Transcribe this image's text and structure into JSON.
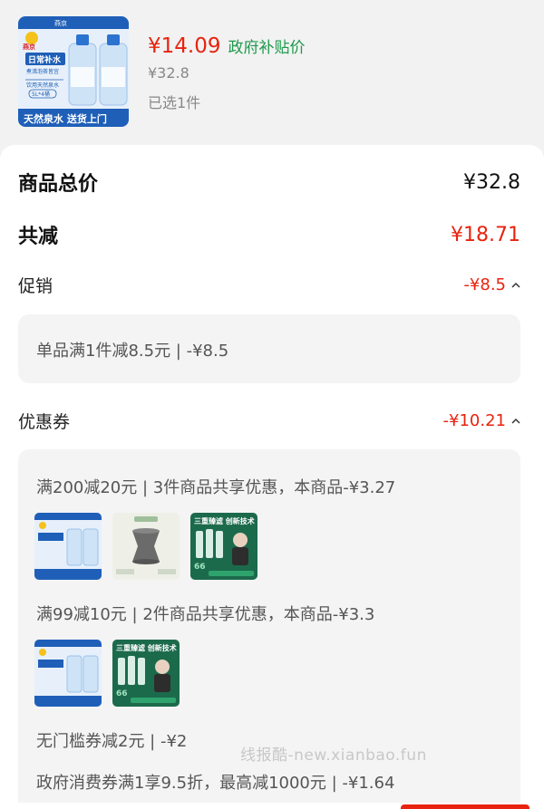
{
  "product": {
    "price": "¥14.09",
    "price_tag": "政府补贴价",
    "original_price": "¥32.8",
    "selected_count": "已选1件",
    "thumb": {
      "brand": "燕京",
      "badge_top": "日常补水",
      "badge_sub": "煮沸泡茶皆宜",
      "label": "饮用天然泉水",
      "spec": "5L*4桶",
      "banner": "天然泉水 送货上门"
    }
  },
  "summary": {
    "total_label": "商品总价",
    "total_value": "¥32.8",
    "discount_label": "共减",
    "discount_value": "¥18.71"
  },
  "promotion": {
    "label": "促销",
    "value": "-¥8.5",
    "detail": "单品满1件减8.5元 | -¥8.5"
  },
  "coupons": {
    "label": "优惠券",
    "value": "-¥10.21",
    "items": [
      "满200减20元 | 3件商品共享优惠，本商品-¥3.27",
      "满99减10元 | 2件商品共享优惠，本商品-¥3.3",
      "无门槛券减2元 | -¥2",
      "政府消费券满1享9.5折，最高减1000元 | -¥1.64"
    ],
    "green_product": {
      "title": "三重臻滤 创新技术",
      "num": "66"
    }
  },
  "watermark": "线报酷-new.xianbao.fun",
  "colors": {
    "accent_red": "#e8230f",
    "subsidy_green": "#1c9a4b",
    "water_blue": "#1f5fb8"
  }
}
